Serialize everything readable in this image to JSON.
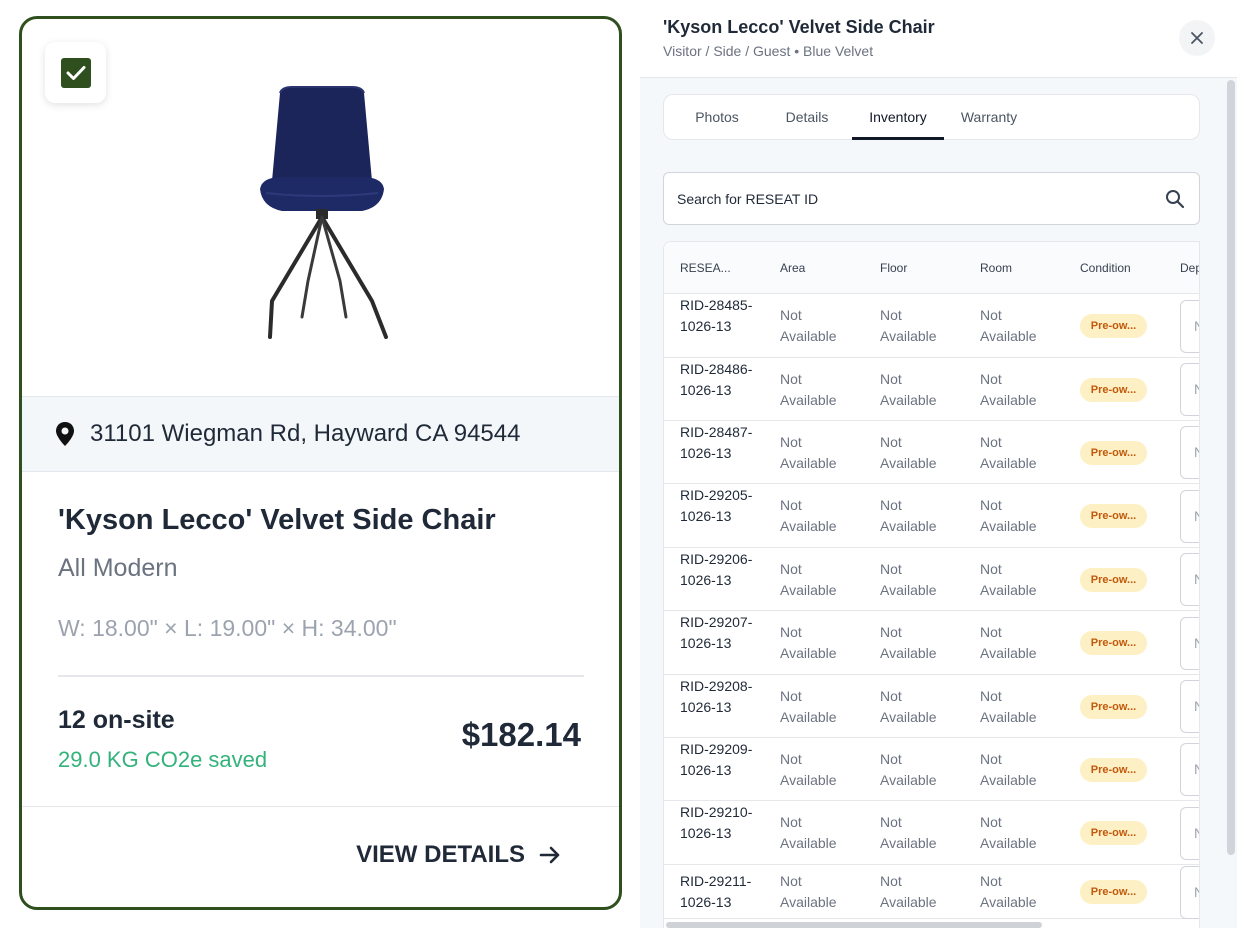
{
  "card": {
    "checkbox_checked": true,
    "image_alt": "Blue velvet side chair",
    "address": "31101 Wiegman Rd, Hayward CA 94544",
    "title": "'Kyson Lecco' Velvet Side Chair",
    "brand": "All Modern",
    "dimensions": "W: 18.00\" × L: 19.00\" × H: 34.00\"",
    "onsite": "12 on-site",
    "co2": "29.0 KG CO2e saved",
    "price": "$182.14",
    "view_details": "VIEW DETAILS"
  },
  "panel": {
    "title": "'Kyson Lecco' Velvet Side Chair",
    "subtitle": "Visitor / Side / Guest • Blue Velvet",
    "tabs": [
      {
        "label": "Photos",
        "active": false
      },
      {
        "label": "Details",
        "active": false
      },
      {
        "label": "Inventory",
        "active": true
      },
      {
        "label": "Warranty",
        "active": false
      }
    ],
    "search": {
      "placeholder": "Search for RESEAT ID"
    },
    "table": {
      "headers": [
        "RESEA...",
        "Area",
        "Floor",
        "Room",
        "Condition",
        "Dep"
      ],
      "rows": [
        {
          "rid": "RID-28485-1026-13",
          "area": "Not Available",
          "floor": "Not Available",
          "room": "Not Available",
          "condition": "Pre-ow...",
          "dep": "N"
        },
        {
          "rid": "RID-28486-1026-13",
          "area": "Not Available",
          "floor": "Not Available",
          "room": "Not Available",
          "condition": "Pre-ow...",
          "dep": "N"
        },
        {
          "rid": "RID-28487-1026-13",
          "area": "Not Available",
          "floor": "Not Available",
          "room": "Not Available",
          "condition": "Pre-ow...",
          "dep": "N"
        },
        {
          "rid": "RID-29205-1026-13",
          "area": "Not Available",
          "floor": "Not Available",
          "room": "Not Available",
          "condition": "Pre-ow...",
          "dep": "N"
        },
        {
          "rid": "RID-29206-1026-13",
          "area": "Not Available",
          "floor": "Not Available",
          "room": "Not Available",
          "condition": "Pre-ow...",
          "dep": "N"
        },
        {
          "rid": "RID-29207-1026-13",
          "area": "Not Available",
          "floor": "Not Available",
          "room": "Not Available",
          "condition": "Pre-ow...",
          "dep": "N"
        },
        {
          "rid": "RID-29208-1026-13",
          "area": "Not Available",
          "floor": "Not Available",
          "room": "Not Available",
          "condition": "Pre-ow...",
          "dep": "N"
        },
        {
          "rid": "RID-29209-1026-13",
          "area": "Not Available",
          "floor": "Not Available",
          "room": "Not Available",
          "condition": "Pre-ow...",
          "dep": "N"
        },
        {
          "rid": "RID-29210-1026-13",
          "area": "Not Available",
          "floor": "Not Available",
          "room": "Not Available",
          "condition": "Pre-ow...",
          "dep": "N"
        },
        {
          "rid": "RID-29211-1026-13",
          "area": "Not Available",
          "floor": "Not Available",
          "room": "Not Available",
          "condition": "Pre-ow...",
          "dep": "N"
        }
      ]
    }
  },
  "colors": {
    "brand_green": "#2f4f1f",
    "co2_green": "#34b27b",
    "badge_bg": "#fdf0c4",
    "badge_text": "#c2590d"
  },
  "icons": {
    "checkbox": "check-icon",
    "pin": "map-pin-icon",
    "arrow": "arrow-right-icon",
    "close": "close-icon",
    "search": "search-icon"
  }
}
